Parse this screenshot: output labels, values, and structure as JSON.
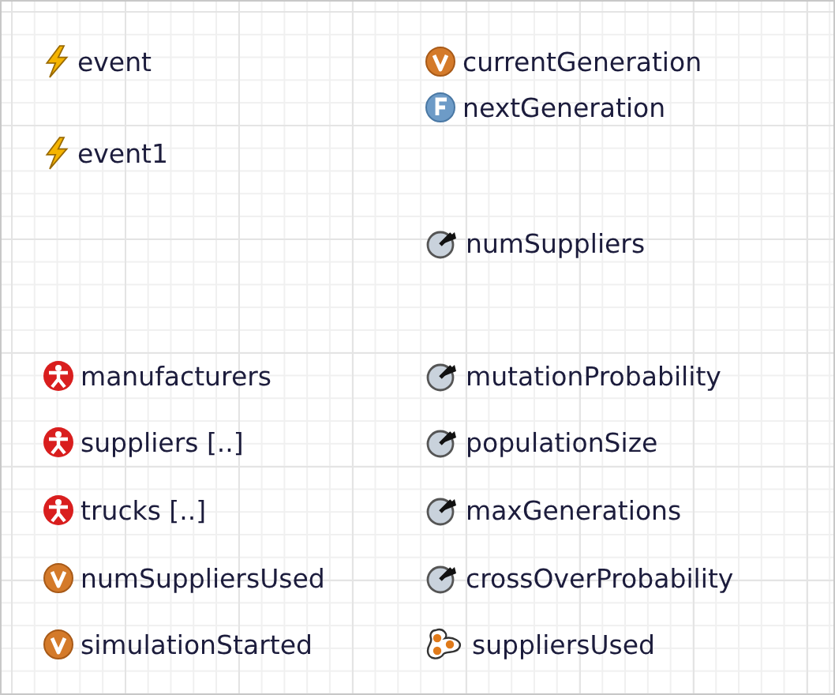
{
  "canvas_items": [
    {
      "kind": "event",
      "label": "event"
    },
    {
      "kind": "event",
      "label": "event1"
    },
    {
      "kind": "population",
      "label": "manufacturers"
    },
    {
      "kind": "population",
      "label": "suppliers [..]"
    },
    {
      "kind": "population",
      "label": "trucks [..]"
    },
    {
      "kind": "variable",
      "label": "numSuppliersUsed"
    },
    {
      "kind": "variable",
      "label": "simulationStarted"
    },
    {
      "kind": "variable",
      "label": "currentGeneration"
    },
    {
      "kind": "function",
      "label": "nextGeneration"
    },
    {
      "kind": "parameter",
      "label": "numSuppliers"
    },
    {
      "kind": "parameter",
      "label": "mutationProbability"
    },
    {
      "kind": "parameter",
      "label": "populationSize"
    },
    {
      "kind": "parameter",
      "label": "maxGenerations"
    },
    {
      "kind": "parameter",
      "label": "crossOverProbability"
    },
    {
      "kind": "collection",
      "label": "suppliersUsed"
    }
  ]
}
